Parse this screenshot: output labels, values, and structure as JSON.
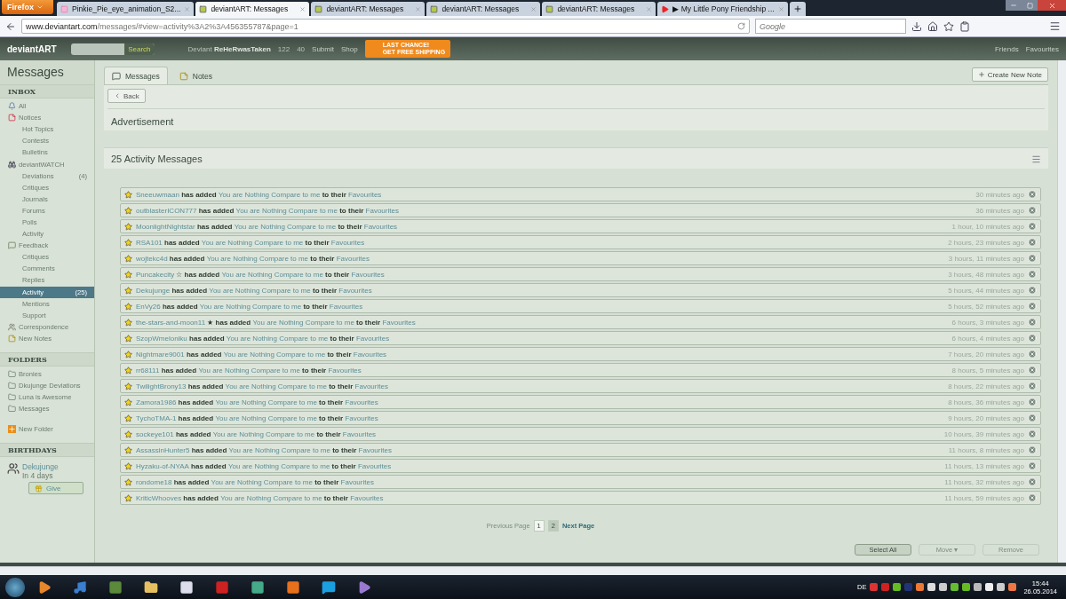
{
  "browser": {
    "menu_button": "Firefox",
    "tabs": [
      {
        "title": "Pinkie_Pie_eye_animation_S2...",
        "selected": false,
        "kind": "pony"
      },
      {
        "title": "deviantART: Messages",
        "selected": true,
        "kind": "da"
      },
      {
        "title": "deviantART: Messages",
        "selected": false,
        "kind": "da"
      },
      {
        "title": "deviantART: Messages",
        "selected": false,
        "kind": "da"
      },
      {
        "title": "deviantART: Messages",
        "selected": false,
        "kind": "da"
      },
      {
        "title": "▶ My Little Pony Friendship ...",
        "selected": false,
        "kind": "video"
      }
    ],
    "url_host": "www.deviantart.com",
    "url_path": "/messages/#view=activity%3A2%3A456355787&page=1",
    "search_placeholder": "Google"
  },
  "header": {
    "logo": "deviantART",
    "search_button": "Search",
    "user_prefix": "Deviant",
    "username": "ReHeRwasTaken",
    "watch_count": "122",
    "notes_count": "40",
    "submit": "Submit",
    "shop": "Shop",
    "promo_top": "LAST CHANCE!",
    "promo_bottom": "GET FREE SHIPPING",
    "friends": "Friends",
    "favourites": "Favourites"
  },
  "sidebar": {
    "title": "Messages",
    "inbox": {
      "heading": "INBOX",
      "items": [
        {
          "label": "All",
          "selected": false,
          "kind": "all"
        },
        {
          "label": "Notices",
          "selected": false,
          "kind": "notices",
          "children": [
            {
              "label": "Hot Topics",
              "selected": false
            },
            {
              "label": "Contests",
              "selected": false
            },
            {
              "label": "Bulletins",
              "selected": false
            }
          ]
        },
        {
          "label": "deviantWATCH",
          "selected": false,
          "kind": "watch",
          "children": [
            {
              "label": "Deviations",
              "count": "(4)",
              "selected": false
            },
            {
              "label": "Critiques",
              "selected": false
            },
            {
              "label": "Journals",
              "selected": false
            },
            {
              "label": "Forums",
              "selected": false
            },
            {
              "label": "Polls",
              "selected": false
            },
            {
              "label": "Activity",
              "selected": false
            }
          ]
        },
        {
          "label": "Feedback",
          "selected": false,
          "kind": "feedback",
          "children": [
            {
              "label": "Critiques",
              "selected": false
            },
            {
              "label": "Comments",
              "selected": false
            },
            {
              "label": "Replies",
              "selected": false
            },
            {
              "label": "Activity",
              "count": "(25)",
              "selected": true
            },
            {
              "label": "Mentions",
              "selected": false
            },
            {
              "label": "Support",
              "selected": false
            }
          ]
        },
        {
          "label": "Correspondence",
          "selected": false,
          "kind": "correspondence"
        },
        {
          "label": "New Notes",
          "selected": false,
          "kind": "notes"
        }
      ]
    },
    "folders": {
      "heading": "FOLDERS",
      "items": [
        {
          "label": "Bronies"
        },
        {
          "label": "Dkujunge Deviations"
        },
        {
          "label": "Luna is Awesome"
        },
        {
          "label": "Messages"
        }
      ],
      "new_folder": "New Folder"
    },
    "birthdays": {
      "heading": "BIRTHDAYS",
      "name": "Dekujunge",
      "when": "In 4 days",
      "give": "Give"
    }
  },
  "main": {
    "tabs": [
      {
        "label": "Messages",
        "selected": true,
        "kind": "messages"
      },
      {
        "label": "Notes",
        "selected": false,
        "kind": "notes"
      }
    ],
    "create_note": "Create New Note",
    "back": "Back",
    "advertisement": "Advertisement",
    "list_title": "25 Activity Messages",
    "messages": [
      {
        "user": "Sneeuwmaan",
        "action": "has added",
        "deviation": "You are Nothing Compare to me",
        "connector": "to their",
        "target": "Favourites",
        "time": "30 minutes ago"
      },
      {
        "user": "outblasterICON777",
        "action": "has added",
        "deviation": "You are Nothing Compare to me",
        "connector": "to their",
        "target": "Favourites",
        "time": "36 minutes ago"
      },
      {
        "user": "MoonlightNightstar",
        "action": "has added",
        "deviation": "You are Nothing Compare to me",
        "connector": "to their",
        "target": "Favourites",
        "time": "1 hour, 10 minutes ago"
      },
      {
        "user": "RSA101",
        "action": "has added",
        "deviation": "You are Nothing Compare to me",
        "connector": "to their",
        "target": "Favourites",
        "time": "2 hours, 23 minutes ago"
      },
      {
        "user": "wojtekc4d",
        "action": "has added",
        "deviation": "You are Nothing Compare to me",
        "connector": "to their",
        "target": "Favourites",
        "time": "3 hours, 11 minutes ago"
      },
      {
        "user": "Puncakecity",
        "badge": "☆",
        "action": "has added",
        "deviation": "You are Nothing Compare to me",
        "connector": "to their",
        "target": "Favourites",
        "time": "3 hours, 48 minutes ago"
      },
      {
        "user": "Dekujunge",
        "action": "has added",
        "deviation": "You are Nothing Compare to me",
        "connector": "to their",
        "target": "Favourites",
        "time": "5 hours, 44 minutes ago"
      },
      {
        "user": "EnVy26",
        "action": "has added",
        "deviation": "You are Nothing Compare to me",
        "connector": "to their",
        "target": "Favourites",
        "time": "5 hours, 52 minutes ago"
      },
      {
        "user": "the-stars-and-moon11",
        "badge": "★",
        "action": "has added",
        "deviation": "You are Nothing Compare to me",
        "connector": "to their",
        "target": "Favourites",
        "time": "6 hours, 3 minutes ago"
      },
      {
        "user": "SzopWmeloniku",
        "action": "has added",
        "deviation": "You are Nothing Compare to me",
        "connector": "to their",
        "target": "Favourites",
        "time": "6 hours, 4 minutes ago"
      },
      {
        "user": "Nightmare9001",
        "action": "has added",
        "deviation": "You are Nothing Compare to me",
        "connector": "to their",
        "target": "Favourites",
        "time": "7 hours, 20 minutes ago"
      },
      {
        "user": "rr68111",
        "action": "has added",
        "deviation": "You are Nothing Compare to me",
        "connector": "to their",
        "target": "Favourites",
        "time": "8 hours, 5 minutes ago"
      },
      {
        "user": "TwilightBrony13",
        "action": "has added",
        "deviation": "You are Nothing Compare to me",
        "connector": "to their",
        "target": "Favourites",
        "time": "8 hours, 22 minutes ago"
      },
      {
        "user": "Zamora1986",
        "action": "has added",
        "deviation": "You are Nothing Compare to me",
        "connector": "to their",
        "target": "Favourites",
        "time": "8 hours, 36 minutes ago"
      },
      {
        "user": "TychoTMA-1",
        "action": "has added",
        "deviation": "You are Nothing Compare to me",
        "connector": "to their",
        "target": "Favourites",
        "time": "9 hours, 20 minutes ago"
      },
      {
        "user": "sockeye101",
        "action": "has added",
        "deviation": "You are Nothing Compare to me",
        "connector": "to their",
        "target": "Favourites",
        "time": "10 hours, 39 minutes ago"
      },
      {
        "user": "AssassinHunter5",
        "action": "has added",
        "deviation": "You are Nothing Compare to me",
        "connector": "to their",
        "target": "Favourites",
        "time": "11 hours, 8 minutes ago"
      },
      {
        "user": "Hyzaku-of-NYAA",
        "action": "has added",
        "deviation": "You are Nothing Compare to me",
        "connector": "to their",
        "target": "Favourites",
        "time": "11 hours, 13 minutes ago"
      },
      {
        "user": "rondome18",
        "action": "has added",
        "deviation": "You are Nothing Compare to me",
        "connector": "to their",
        "target": "Favourites",
        "time": "11 hours, 32 minutes ago"
      },
      {
        "user": "KriticWhooves",
        "action": "has added",
        "deviation": "You are Nothing Compare to me",
        "connector": "to their",
        "target": "Favourites",
        "time": "11 hours, 59 minutes ago"
      }
    ],
    "pagination": {
      "previous": "Previous Page",
      "pages": [
        {
          "label": "1",
          "selected": true
        },
        {
          "label": "2",
          "selected": false
        }
      ],
      "next": "Next Page"
    },
    "actions": [
      {
        "label": "Select All",
        "disabled": false
      },
      {
        "label": "Move ▾",
        "disabled": true
      },
      {
        "label": "Remove",
        "disabled": true
      }
    ]
  },
  "taskbar": {
    "language": "DE",
    "time": "15:44",
    "date": "26.05.2014"
  }
}
